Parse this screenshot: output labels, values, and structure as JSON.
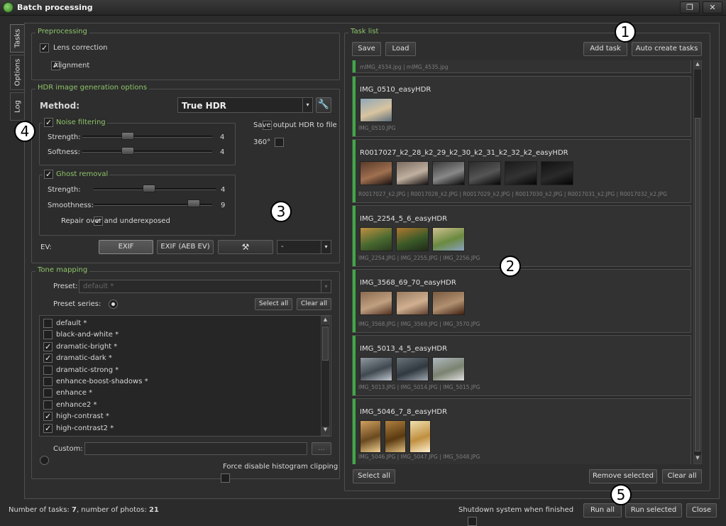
{
  "window": {
    "title": "Batch processing",
    "restore_icon": "restore-icon",
    "close_icon": "close-icon"
  },
  "side_tabs": [
    "Tasks",
    "Options",
    "Log"
  ],
  "preprocessing": {
    "title": "Preprocessing",
    "lens_correction": {
      "label": "Lens correction",
      "checked": true
    },
    "alignment": {
      "label": "Alignment",
      "checked": true
    }
  },
  "hdr": {
    "title": "HDR image generation options",
    "method_label": "Method:",
    "method_value": "True HDR",
    "noise": {
      "label": "Noise filtering",
      "checked": true,
      "strength_label": "Strength:",
      "strength_value": "4",
      "softness_label": "Softness:",
      "softness_value": "4"
    },
    "save_output_label": "Save output HDR to file",
    "deg360_label": "360°",
    "ghost": {
      "label": "Ghost removal",
      "checked": true,
      "strength_label": "Strength:",
      "strength_value": "4",
      "smoothness_label": "Smoothness:",
      "smoothness_value": "9",
      "repair_label": "Repair over and underexposed"
    },
    "ev_label": "EV:",
    "ev_buttons": [
      "EXIF",
      "EXIF (AEB EV)"
    ],
    "ev_select": "-"
  },
  "tone": {
    "title": "Tone mapping",
    "preset_label": "Preset:",
    "preset_value": "default *",
    "preset_series_label": "Preset series:",
    "select_all": "Select all",
    "clear_all": "Clear all",
    "presets": [
      {
        "name": "default *",
        "checked": false
      },
      {
        "name": "black-and-white *",
        "checked": false
      },
      {
        "name": "dramatic-bright *",
        "checked": true
      },
      {
        "name": "dramatic-dark *",
        "checked": true
      },
      {
        "name": "dramatic-strong *",
        "checked": false
      },
      {
        "name": "enhance-boost-shadows *",
        "checked": false
      },
      {
        "name": "enhance *",
        "checked": false
      },
      {
        "name": "enhance2 *",
        "checked": false
      },
      {
        "name": "high-contrast *",
        "checked": true
      },
      {
        "name": "high-contrast2 *",
        "checked": true
      }
    ],
    "custom_label": "Custom:",
    "custom_browse": "...",
    "force_disable_label": "Force disable histogram clipping"
  },
  "task_list": {
    "title": "Task list",
    "save": "Save",
    "load": "Load",
    "add_task": "Add task",
    "auto_create": "Auto create tasks",
    "partial_files": "mIMG_4534.jpg | mIMG_4535.jpg",
    "tasks": [
      {
        "name": "IMG_0510_easyHDR",
        "files": "IMG_0510.JPG"
      },
      {
        "name": "R0017027_k2_28_k2_29_k2_30_k2_31_k2_32_k2_easyHDR",
        "files": "R0017027_k2.JPG | R0017028_k2.JPG | R0017029_k2.JPG | R0017030_k2.JPG | R0017031_k2.JPG | R0017032_k2.JPG"
      },
      {
        "name": "IMG_2254_5_6_easyHDR",
        "files": "IMG_2254.JPG | IMG_2255.JPG | IMG_2256.JPG"
      },
      {
        "name": "IMG_3568_69_70_easyHDR",
        "files": "IMG_3568.JPG | IMG_3569.JPG | IMG_3570.JPG"
      },
      {
        "name": "IMG_5013_4_5_easyHDR",
        "files": "IMG_5013.JPG | IMG_5014.JPG | IMG_5015.JPG"
      },
      {
        "name": "IMG_5046_7_8_easyHDR",
        "files": "IMG_5046.JPG | IMG_5047.JPG | IMG_5048.JPG"
      }
    ],
    "select_all": "Select all",
    "remove_selected": "Remove selected",
    "clear_all": "Clear all"
  },
  "footer": {
    "status_prefix": "Number of tasks: ",
    "tasks_count": "7",
    "status_middle": ", number of photos: ",
    "photos_count": "21",
    "shutdown_label": "Shutdown system when finished",
    "run_all": "Run all",
    "run_selected": "Run selected",
    "close": "Close"
  },
  "callouts": [
    "1",
    "2",
    "3",
    "4",
    "5"
  ],
  "colors": {
    "accent_green": "#8ec46a",
    "task_bar": "#3fa945",
    "background": "#2b2b2b"
  }
}
